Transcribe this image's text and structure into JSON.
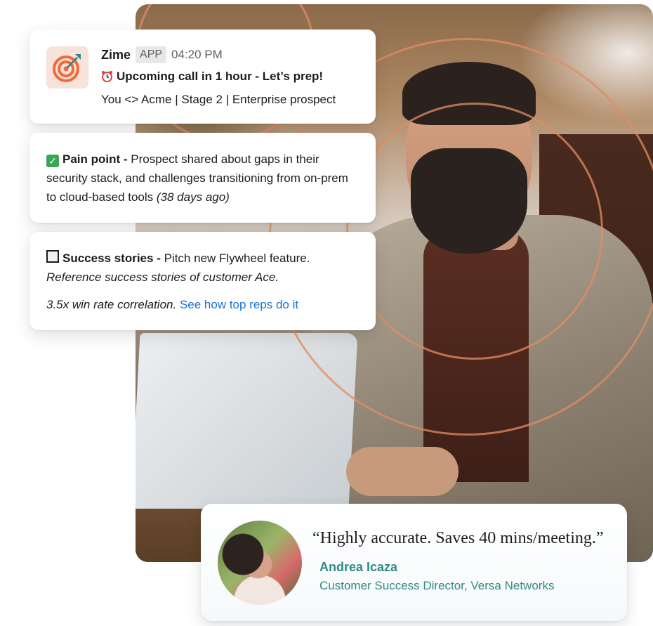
{
  "notification": {
    "app_name": "Zime",
    "app_badge": "APP",
    "time": "04:20 PM",
    "headline": "Upcoming call in 1 hour - Let’s prep!",
    "context": "You <> Acme | Stage 2 | Enterprise prospect",
    "logo_icon": "target-icon",
    "clock_icon": "alarm-clock-icon"
  },
  "pain_point": {
    "icon": "check-mark-icon",
    "label": "Pain point -",
    "text": "Prospect shared about gaps in their security stack, and challenges transitioning from on-prem to cloud-based tools",
    "age": "(38 days ago)"
  },
  "success_stories": {
    "icon": "checkbox-icon",
    "label": "Success stories -",
    "text": "Pitch new Flywheel feature.",
    "reference": "Reference success stories of customer Ace.",
    "stat": "3.5x win rate correlation.",
    "link_text": "See how top reps do it"
  },
  "testimonial": {
    "quote": "“Highly accurate. Saves 40 mins/meeting.”",
    "name": "Andrea Icaza",
    "title": "Customer Success Director, Versa Networks"
  },
  "colors": {
    "accent_orange": "#f06a3c",
    "link_blue": "#1d6fd6",
    "teal": "#2f8a86"
  }
}
